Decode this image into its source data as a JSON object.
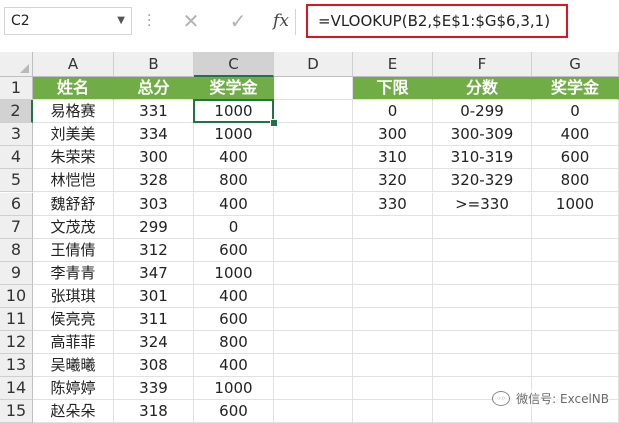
{
  "formula_bar": {
    "name_box": "C2",
    "cancel_glyph": "✕",
    "enter_glyph": "✓",
    "fx_label": "fx",
    "formula": "=VLOOKUP(B2,$E$1:$G$6,3,1)"
  },
  "columns": [
    "A",
    "B",
    "C",
    "D",
    "E",
    "F",
    "G"
  ],
  "rows": [
    "1",
    "2",
    "3",
    "4",
    "5",
    "6",
    "7",
    "8",
    "9",
    "10",
    "11",
    "12",
    "13",
    "14",
    "15"
  ],
  "left_table": {
    "headers": [
      "姓名",
      "总分",
      "奖学金"
    ],
    "rows": [
      [
        "易格赛",
        "331",
        "1000"
      ],
      [
        "刘美美",
        "334",
        "1000"
      ],
      [
        "朱荣荣",
        "300",
        "400"
      ],
      [
        "林恺恺",
        "328",
        "800"
      ],
      [
        "魏舒舒",
        "303",
        "400"
      ],
      [
        "文茂茂",
        "299",
        "0"
      ],
      [
        "王倩倩",
        "312",
        "600"
      ],
      [
        "李青青",
        "347",
        "1000"
      ],
      [
        "张琪琪",
        "301",
        "400"
      ],
      [
        "侯亮亮",
        "311",
        "600"
      ],
      [
        "高菲菲",
        "324",
        "800"
      ],
      [
        "吴曦曦",
        "308",
        "400"
      ],
      [
        "陈婷婷",
        "339",
        "1000"
      ],
      [
        "赵朵朵",
        "318",
        "600"
      ]
    ]
  },
  "right_table": {
    "headers": [
      "下限",
      "分数",
      "奖学金"
    ],
    "rows": [
      [
        "0",
        "0-299",
        "0"
      ],
      [
        "300",
        "300-309",
        "400"
      ],
      [
        "310",
        "310-319",
        "600"
      ],
      [
        "320",
        "320-329",
        "800"
      ],
      [
        "330",
        ">=330",
        "1000"
      ]
    ]
  },
  "watermark": "微信号: ExcelNB",
  "colors": {
    "header_green": "#70ad47",
    "selection_green": "#217346",
    "formula_highlight": "#e0141e"
  }
}
